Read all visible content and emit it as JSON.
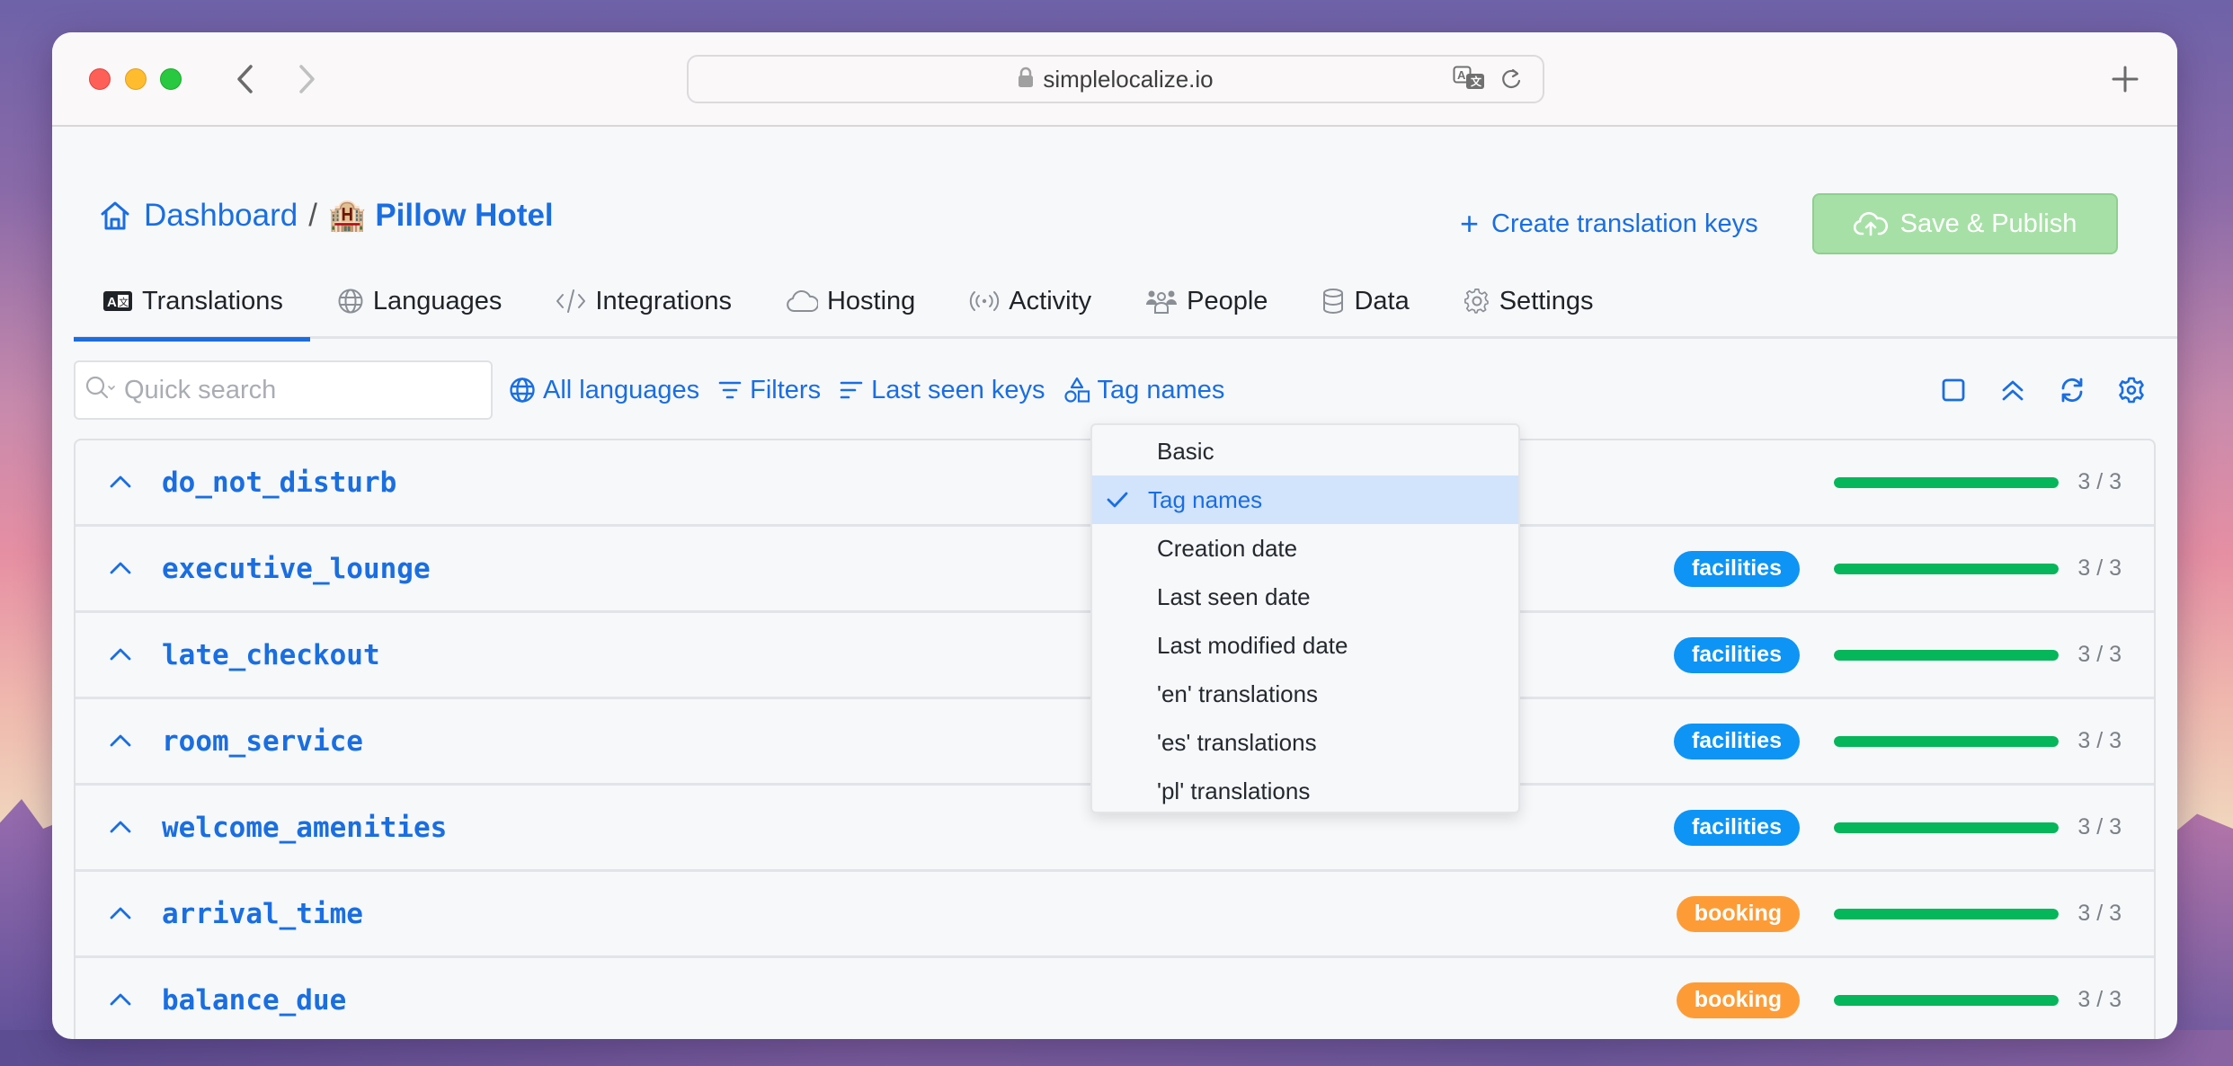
{
  "browser": {
    "url": "simplelocalize.io",
    "icons": {
      "back": "chevron-left-icon",
      "forward": "chevron-right-icon",
      "lock": "lock-icon",
      "translate": "translate-icon",
      "reload": "reload-icon",
      "new_tab": "plus-icon"
    }
  },
  "header": {
    "breadcrumb": {
      "home_label": "Dashboard",
      "separator": "/",
      "project_emoji": "🏨",
      "project_name": "Pillow Hotel"
    },
    "create_keys_label": "Create translation keys",
    "create_keys_plus": "+",
    "save_publish_label": "Save & Publish"
  },
  "tabs": [
    {
      "label": "Translations",
      "icon": "translate-box-icon",
      "active": true
    },
    {
      "label": "Languages",
      "icon": "globe-icon",
      "active": false
    },
    {
      "label": "Integrations",
      "icon": "code-icon",
      "active": false
    },
    {
      "label": "Hosting",
      "icon": "cloud-icon",
      "active": false
    },
    {
      "label": "Activity",
      "icon": "broadcast-icon",
      "active": false
    },
    {
      "label": "People",
      "icon": "people-icon",
      "active": false
    },
    {
      "label": "Data",
      "icon": "database-icon",
      "active": false
    },
    {
      "label": "Settings",
      "icon": "gear-icon",
      "active": false
    }
  ],
  "toolbar": {
    "search": {
      "value": "",
      "placeholder": "Quick search"
    },
    "all_languages": "All languages",
    "filters": "Filters",
    "sort": "Last seen keys",
    "view": "Tag names",
    "right_icons": [
      "checkbox-icon",
      "collapse-all-icon",
      "refresh-icon",
      "settings-icon"
    ]
  },
  "dropdown": {
    "items": [
      {
        "label": "Basic",
        "selected": false
      },
      {
        "label": "Tag names",
        "selected": true
      },
      {
        "label": "Creation date",
        "selected": false
      },
      {
        "label": "Last seen date",
        "selected": false
      },
      {
        "label": "Last modified date",
        "selected": false
      },
      {
        "label": "'en' translations",
        "selected": false
      },
      {
        "label": "'es' translations",
        "selected": false
      },
      {
        "label": "'pl' translations",
        "selected": false
      }
    ]
  },
  "colors": {
    "accent": "#1a6ee0",
    "progress": "#05b65a",
    "tag_facilities": "#0d94f5",
    "tag_booking": "#fd9c37",
    "save_button": "#a7e0a7"
  },
  "keys": [
    {
      "name": "do_not_disturb",
      "tag": null,
      "tag_color": null,
      "done": 3,
      "total": 3,
      "count": "3 / 3"
    },
    {
      "name": "executive_lounge",
      "tag": "facilities",
      "tag_color": "#0d94f5",
      "done": 3,
      "total": 3,
      "count": "3 / 3"
    },
    {
      "name": "late_checkout",
      "tag": "facilities",
      "tag_color": "#0d94f5",
      "done": 3,
      "total": 3,
      "count": "3 / 3"
    },
    {
      "name": "room_service",
      "tag": "facilities",
      "tag_color": "#0d94f5",
      "done": 3,
      "total": 3,
      "count": "3 / 3"
    },
    {
      "name": "welcome_amenities",
      "tag": "facilities",
      "tag_color": "#0d94f5",
      "done": 3,
      "total": 3,
      "count": "3 / 3"
    },
    {
      "name": "arrival_time",
      "tag": "booking",
      "tag_color": "#fd9c37",
      "done": 3,
      "total": 3,
      "count": "3 / 3"
    },
    {
      "name": "balance_due",
      "tag": "booking",
      "tag_color": "#fd9c37",
      "done": 3,
      "total": 3,
      "count": "3 / 3"
    }
  ]
}
